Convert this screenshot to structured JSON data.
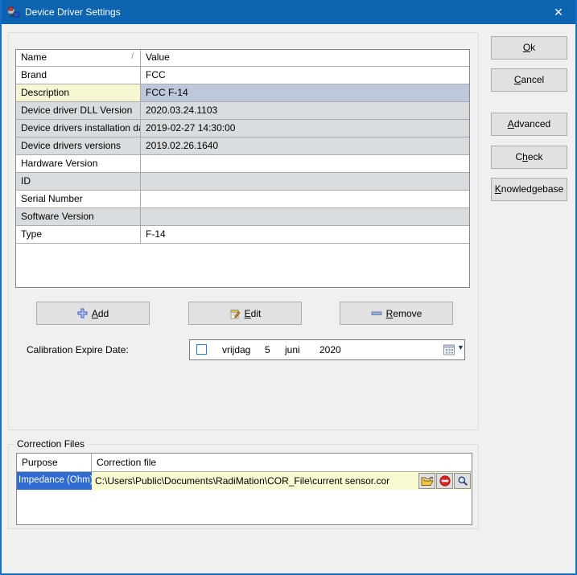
{
  "window": {
    "title": "Device Driver Settings",
    "close_glyph": "✕"
  },
  "properties_table": {
    "headers": {
      "name": "Name",
      "value": "Value",
      "sort_indicator": "/"
    },
    "rows": [
      {
        "name": "Brand",
        "value": "FCC",
        "state": "normal"
      },
      {
        "name": "Description",
        "value": "FCC F-14",
        "state": "selected"
      },
      {
        "name": "Device driver DLL Version",
        "value": "2020.03.24.1103",
        "state": "readonly"
      },
      {
        "name": "Device drivers installation date",
        "value": "2019-02-27 14:30:00",
        "state": "readonly"
      },
      {
        "name": "Device drivers versions",
        "value": "2019.02.26.1640",
        "state": "readonly"
      },
      {
        "name": "Hardware Version",
        "value": "",
        "state": "normal"
      },
      {
        "name": "ID",
        "value": "",
        "state": "readonly"
      },
      {
        "name": "Serial Number",
        "value": "",
        "state": "normal"
      },
      {
        "name": "Software Version",
        "value": "",
        "state": "readonly"
      },
      {
        "name": "Type",
        "value": "F-14",
        "state": "normal"
      }
    ]
  },
  "action_buttons": {
    "add": {
      "pre": "",
      "key": "A",
      "post": "dd"
    },
    "edit": {
      "pre": "",
      "key": "E",
      "post": "dit"
    },
    "remove": {
      "pre": "",
      "key": "R",
      "post": "emove"
    }
  },
  "side_buttons": {
    "ok": {
      "pre": "",
      "key": "O",
      "post": "k"
    },
    "cancel": {
      "pre": "",
      "key": "C",
      "post": "ancel"
    },
    "advanced": {
      "pre": "",
      "key": "A",
      "post": "dvanced"
    },
    "check": {
      "pre": "C",
      "key": "h",
      "post": "eck"
    },
    "knowledgebase": {
      "pre": "",
      "key": "K",
      "post": "nowledgebase"
    }
  },
  "calibration": {
    "label": "Calibration Expire Date:",
    "checkbox_checked": false,
    "day_name": "vrijdag",
    "day": "5",
    "month": "juni",
    "year": "2020",
    "dropdown_glyph": "▼"
  },
  "correction_files": {
    "group_label": "Correction Files",
    "headers": {
      "purpose": "Purpose",
      "file": "Correction file"
    },
    "rows": [
      {
        "purpose": "Impedance (Ohm)",
        "file": "C:\\Users\\Public\\Documents\\RadiMation\\COR_File\\current sensor.cor"
      }
    ]
  },
  "colors": {
    "titlebar": "#0c63b0",
    "dialog_bg": "#f0f0f0",
    "readonly_row": "#d9dcde",
    "selected_name_cell": "#f6f6d2",
    "selected_value_cell": "#bdc9da",
    "purpose_selected_cell": "#2f6bd0",
    "file_cell": "#fafad2",
    "button_face": "#e1e1e1",
    "no_entry_red": "#e02222",
    "folder_yellow": "#f5c83c"
  }
}
